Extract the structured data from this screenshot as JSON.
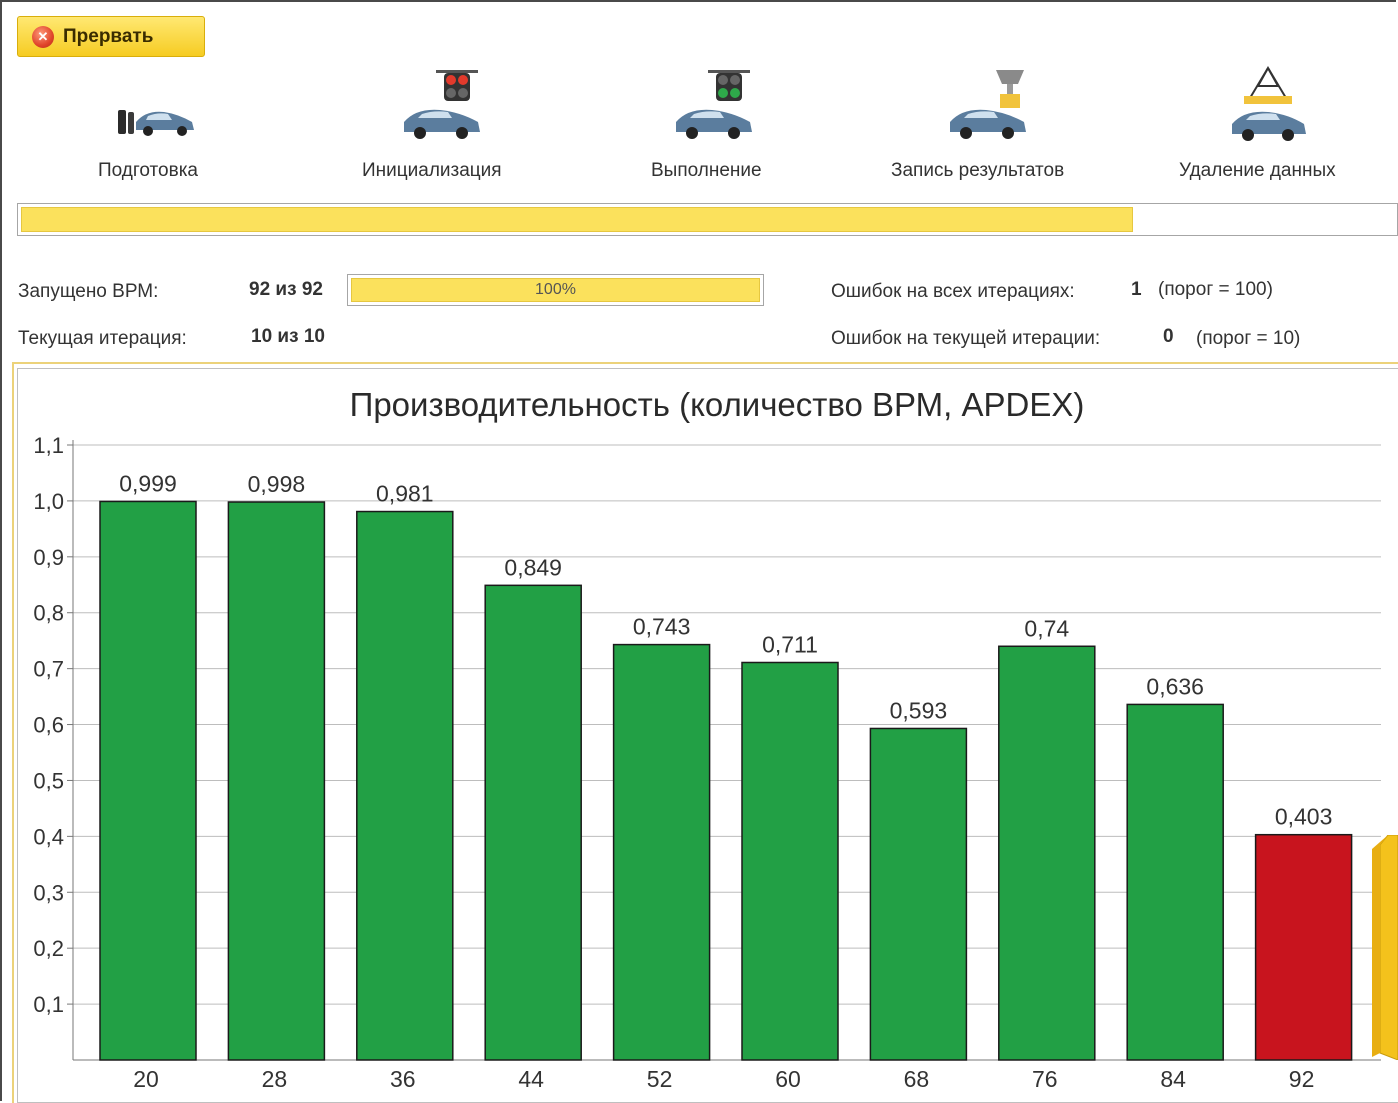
{
  "toolbar": {
    "stop_label": "Прервать",
    "stop_icon": "stop-cross-icon"
  },
  "steps": [
    {
      "label": "Подготовка",
      "icon": "car-preparation-icon"
    },
    {
      "label": "Инициализация",
      "icon": "car-traffic-light-red-icon"
    },
    {
      "label": "Выполнение",
      "icon": "car-traffic-light-green-icon"
    },
    {
      "label": "Запись результатов",
      "icon": "car-trophy-icon"
    },
    {
      "label": "Удаление данных",
      "icon": "car-crane-icon"
    }
  ],
  "main_progress": {
    "fraction": 0.81
  },
  "stats": {
    "vrm_label": "Запущено ВРМ:",
    "vrm_value": "92 из 92",
    "vrm_progress_text": "100%",
    "vrm_fraction": 1.0,
    "iteration_label": "Текущая итерация:",
    "iteration_value": "10 из 10",
    "errors_all_label": "Ошибок на всех итерациях:",
    "errors_all_value": "1",
    "errors_all_threshold": "(порог = 100)",
    "errors_current_label": "Ошибок на текущей итерации:",
    "errors_current_value": "0",
    "errors_current_threshold": "(порог = 10)"
  },
  "colors": {
    "bar_ok": "#22a045",
    "bar_bad": "#c8141e",
    "accent_yellow": "#fbe15c"
  },
  "chart_data": {
    "type": "bar",
    "title": "Производительность (количество ВРМ, APDEX)",
    "categories": [
      "20",
      "28",
      "36",
      "44",
      "52",
      "60",
      "68",
      "76",
      "84",
      "92"
    ],
    "values": [
      0.999,
      0.998,
      0.981,
      0.849,
      0.743,
      0.711,
      0.593,
      0.74,
      0.636,
      0.403
    ],
    "value_labels": [
      "0,999",
      "0,998",
      "0,981",
      "0,849",
      "0,743",
      "0,711",
      "0,593",
      "0,74",
      "0,636",
      "0,403"
    ],
    "bar_colors": [
      "#22a045",
      "#22a045",
      "#22a045",
      "#22a045",
      "#22a045",
      "#22a045",
      "#22a045",
      "#22a045",
      "#22a045",
      "#c8141e"
    ],
    "y_ticks": [
      "0,1",
      "0,2",
      "0,3",
      "0,4",
      "0,5",
      "0,6",
      "0,7",
      "0,8",
      "0,9",
      "1,0",
      "1,1"
    ],
    "y_tick_values": [
      0.1,
      0.2,
      0.3,
      0.4,
      0.5,
      0.6,
      0.7,
      0.8,
      0.9,
      1.0,
      1.1
    ],
    "ylim": [
      0,
      1.1
    ],
    "grid": true,
    "legend": "none"
  }
}
